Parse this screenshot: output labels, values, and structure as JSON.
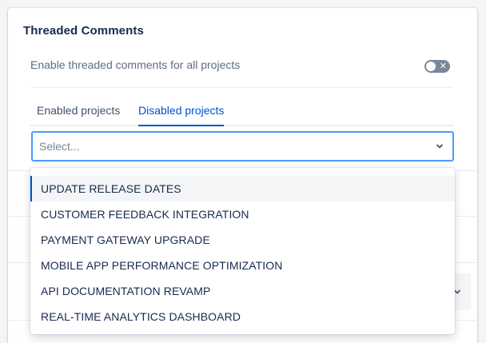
{
  "section": {
    "title": "Threaded Comments"
  },
  "setting": {
    "label": "Enable threaded comments for all projects",
    "toggle_state": "off",
    "toggle_off_glyph": "✕"
  },
  "tabs": [
    {
      "label": "Enabled projects",
      "selected": false
    },
    {
      "label": "Disabled projects",
      "selected": true
    }
  ],
  "select": {
    "placeholder": "Select...",
    "icon": "chevron-down-icon"
  },
  "dropdown": {
    "options": [
      {
        "label": "UPDATE RELEASE DATES",
        "highlighted": true
      },
      {
        "label": "CUSTOMER FEEDBACK INTEGRATION",
        "highlighted": false
      },
      {
        "label": "PAYMENT GATEWAY UPGRADE",
        "highlighted": false
      },
      {
        "label": "MOBILE APP PERFORMANCE OPTIMIZATION",
        "highlighted": false
      },
      {
        "label": "API DOCUMENTATION REVAMP",
        "highlighted": false
      },
      {
        "label": "REAL-TIME ANALYTICS DASHBOARD",
        "highlighted": false
      }
    ]
  },
  "colors": {
    "accent": "#0052cc",
    "focus_border": "#4c9aff",
    "toggle_off": "#7a869a",
    "highlight_bg": "#f4f5f7"
  }
}
